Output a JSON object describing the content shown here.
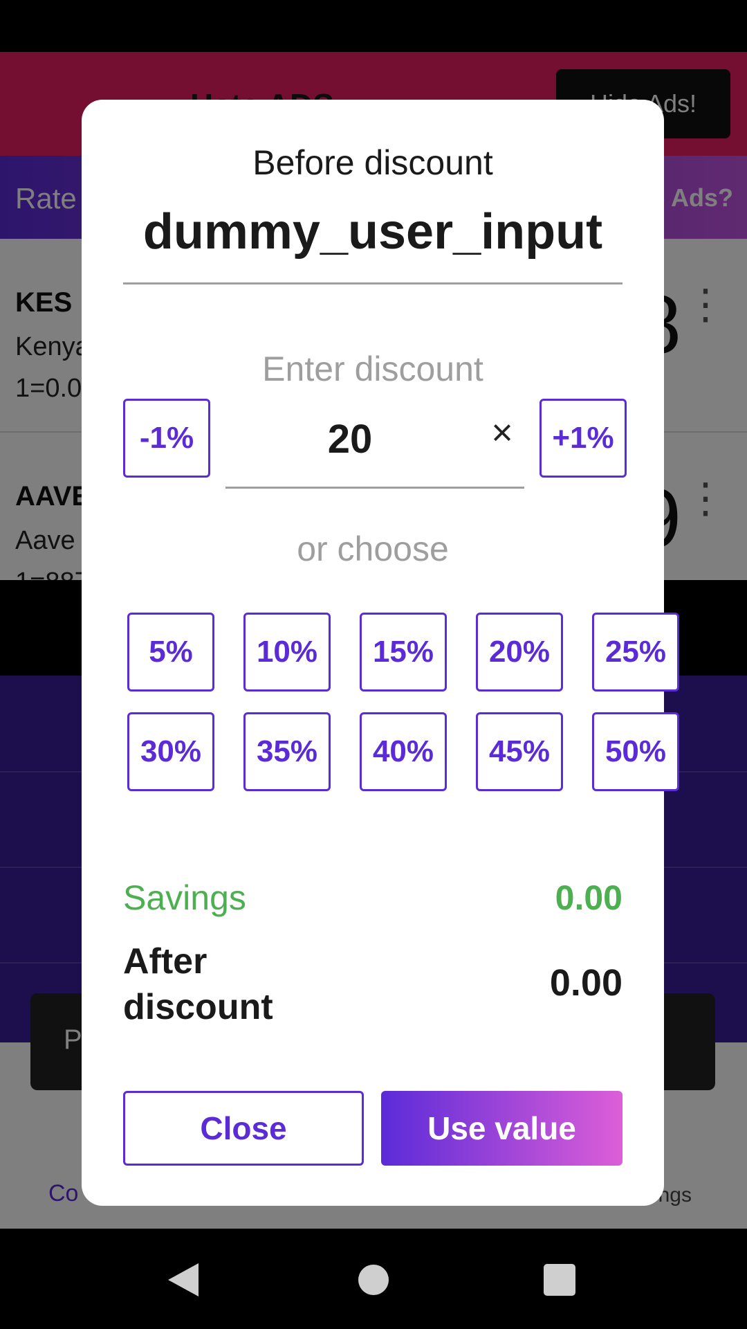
{
  "background_app": {
    "topbar": {
      "title": "Hate ADS",
      "hide_ads_button": "Hide Ads!"
    },
    "ratebar": {
      "left_text": "Rate",
      "right_text": "e Ads?"
    },
    "rows": [
      {
        "code": "KES",
        "name": "Kenya",
        "rate": "1=0.0",
        "value": "8"
      },
      {
        "code": "AAVE",
        "name": "Aave",
        "rate": "1=887",
        "value": "9"
      }
    ],
    "snackbar_text": "P",
    "bottomnav": {
      "converter_label": "Co",
      "settings_label": "ngs"
    }
  },
  "dialog": {
    "title": "Before discount",
    "input_value": "dummy_user_input",
    "enter_label": "Enter discount",
    "minus_label": "-1%",
    "plus_label": "+1%",
    "discount_value": "20",
    "clear_icon": "close-icon",
    "or_label": "or choose",
    "presets": [
      "5%",
      "10%",
      "15%",
      "20%",
      "25%",
      "30%",
      "35%",
      "40%",
      "45%",
      "50%"
    ],
    "savings_label": "Savings",
    "savings_value": "0.00",
    "after_label": "After discount",
    "after_value": "0.00",
    "close_label": "Close",
    "use_label": "Use value"
  },
  "colors": {
    "accent": "#5b2bd8",
    "savings_green": "#4caf50",
    "gradient_end": "#dd5ed8"
  }
}
